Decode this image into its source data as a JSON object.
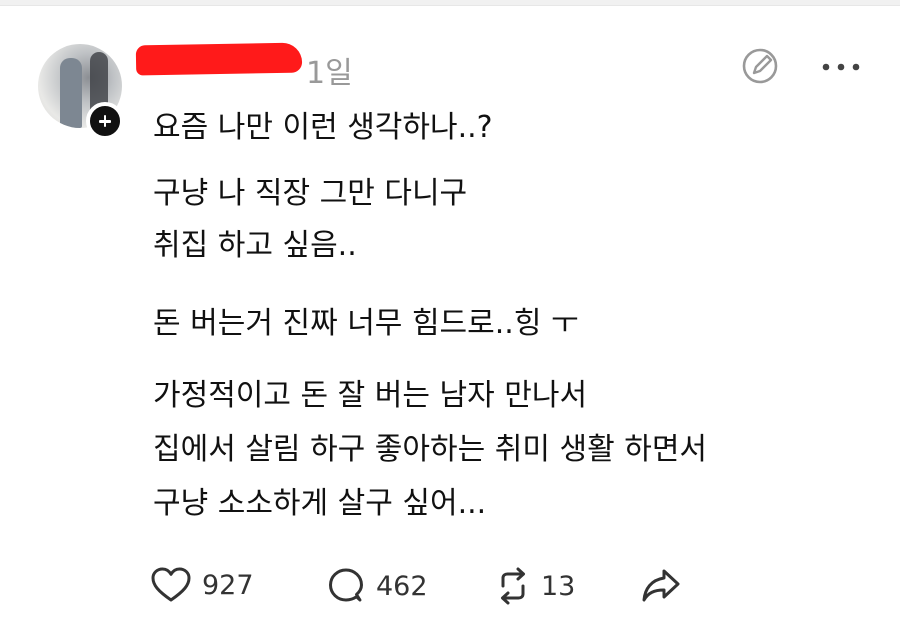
{
  "post": {
    "timestamp": "1일",
    "lines": [
      "요즘 나만 이런 생각하나..?",
      "구냥 나 직장 그만 다니구",
      "취집 하고 싶음..",
      "돈 버는거 진짜 너무 힘드로..힝 ㅜ",
      "가정적이고 돈 잘 버는 남자 만나서",
      "집에서 살림 하구 좋아하는 취미 생활 하면서",
      "구냥 소소하게 살구 싶어..."
    ]
  },
  "actions": {
    "likes": "927",
    "replies": "462",
    "reposts": "13"
  },
  "icons": {
    "header": [
      "edit-icon",
      "more-icon"
    ],
    "actions": [
      "heart-icon",
      "reply-icon",
      "repost-icon",
      "share-icon"
    ]
  },
  "colors": {
    "redaction": "#ff1a1a",
    "timestamp": "#999999",
    "text": "#111111"
  }
}
